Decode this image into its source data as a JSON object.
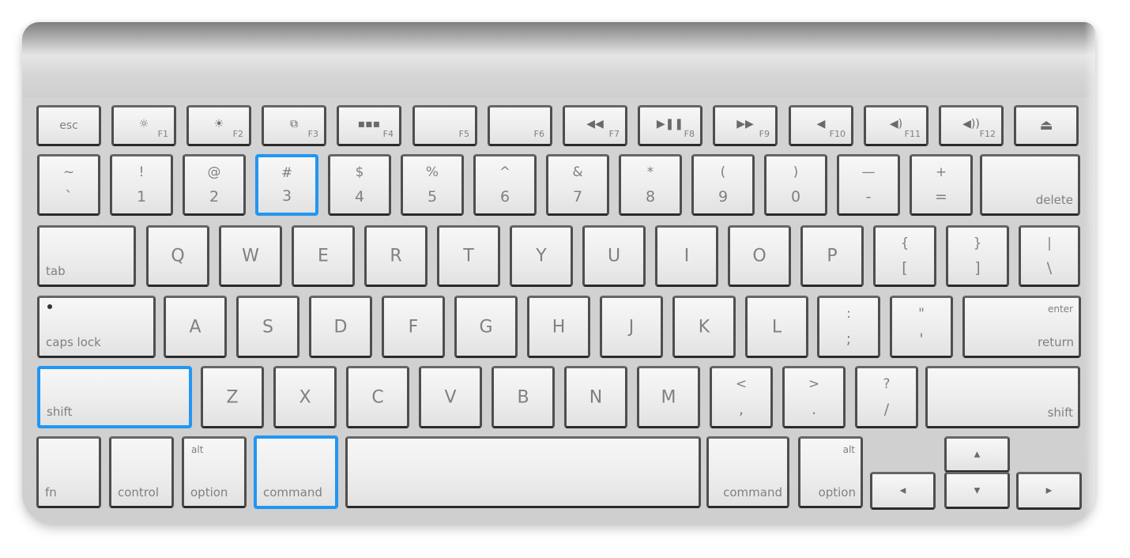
{
  "accent_color": "#2196f3",
  "highlighted_keys": [
    "3",
    "left-shift",
    "left-command"
  ],
  "function_row": [
    {
      "id": "esc",
      "label": "esc"
    },
    {
      "id": "f1",
      "icon": "brightness-down-icon",
      "glyph": "☼",
      "fn": "F1"
    },
    {
      "id": "f2",
      "icon": "brightness-up-icon",
      "glyph": "☀",
      "fn": "F2"
    },
    {
      "id": "f3",
      "icon": "mission-control-icon",
      "glyph": "⧉",
      "fn": "F3"
    },
    {
      "id": "f4",
      "icon": "launchpad-icon",
      "glyph": "▪▪▪",
      "fn": "F4"
    },
    {
      "id": "f5",
      "fn": "F5"
    },
    {
      "id": "f6",
      "fn": "F6"
    },
    {
      "id": "f7",
      "icon": "rewind-icon",
      "glyph": "◀◀",
      "fn": "F7"
    },
    {
      "id": "f8",
      "icon": "play-pause-icon",
      "glyph": "▶❚❚",
      "fn": "F8"
    },
    {
      "id": "f9",
      "icon": "fast-forward-icon",
      "glyph": "▶▶",
      "fn": "F9"
    },
    {
      "id": "f10",
      "icon": "mute-icon",
      "glyph": "◀",
      "fn": "F10"
    },
    {
      "id": "f11",
      "icon": "volume-down-icon",
      "glyph": "◀)",
      "fn": "F11"
    },
    {
      "id": "f12",
      "icon": "volume-up-icon",
      "glyph": "◀))",
      "fn": "F12"
    },
    {
      "id": "eject",
      "icon": "eject-icon",
      "glyph": "⏏"
    }
  ],
  "number_row": [
    {
      "top": "~",
      "bottom": "`"
    },
    {
      "top": "!",
      "bottom": "1"
    },
    {
      "top": "@",
      "bottom": "2"
    },
    {
      "top": "#",
      "bottom": "3"
    },
    {
      "top": "$",
      "bottom": "4"
    },
    {
      "top": "%",
      "bottom": "5"
    },
    {
      "top": "^",
      "bottom": "6"
    },
    {
      "top": "&",
      "bottom": "7"
    },
    {
      "top": "*",
      "bottom": "8"
    },
    {
      "top": "(",
      "bottom": "9"
    },
    {
      "top": ")",
      "bottom": "0"
    },
    {
      "top": "—",
      "bottom": "-"
    },
    {
      "top": "+",
      "bottom": "="
    },
    {
      "label": "delete"
    }
  ],
  "qwerty_row": {
    "tab": "tab",
    "letters": [
      "Q",
      "W",
      "E",
      "R",
      "T",
      "Y",
      "U",
      "I",
      "O",
      "P"
    ],
    "symbols": [
      {
        "top": "{",
        "bottom": "["
      },
      {
        "top": "}",
        "bottom": "]"
      },
      {
        "top": "|",
        "bottom": "\\"
      }
    ]
  },
  "home_row": {
    "caps": "caps lock",
    "letters": [
      "A",
      "S",
      "D",
      "F",
      "G",
      "H",
      "J",
      "K",
      "L"
    ],
    "symbols": [
      {
        "top": ":",
        "bottom": ";"
      },
      {
        "top": "\"",
        "bottom": "'"
      }
    ],
    "return_top": "enter",
    "return_bottom": "return"
  },
  "shift_row": {
    "left_shift": "shift",
    "letters": [
      "Z",
      "X",
      "C",
      "V",
      "B",
      "N",
      "M"
    ],
    "symbols": [
      {
        "top": "<",
        "bottom": ","
      },
      {
        "top": ">",
        "bottom": "."
      },
      {
        "top": "?",
        "bottom": "/"
      }
    ],
    "right_shift": "shift"
  },
  "bottom_row": {
    "fn": "fn",
    "control": "control",
    "left_option_top": "alt",
    "left_option": "option",
    "left_command": "command",
    "right_command": "command",
    "right_option_top": "alt",
    "right_option": "option",
    "arrows": {
      "up": "▲",
      "down": "▼",
      "left": "◀",
      "right": "▶"
    }
  }
}
